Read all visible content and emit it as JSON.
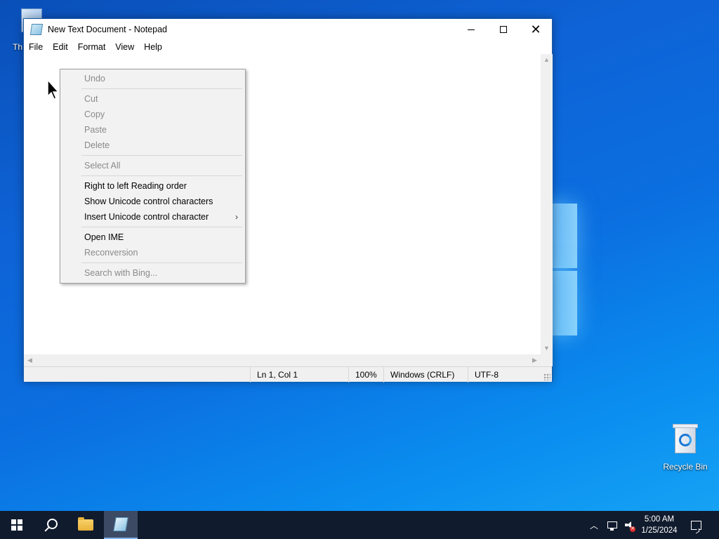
{
  "desktop": {
    "top_icon_label": "Th",
    "recycle_bin_label": "Recycle Bin"
  },
  "window": {
    "title": "New Text Document - Notepad",
    "menu": [
      "File",
      "Edit",
      "Format",
      "View",
      "Help"
    ]
  },
  "status": {
    "position": "Ln 1, Col 1",
    "zoom": "100%",
    "line_endings": "Windows (CRLF)",
    "encoding": "UTF-8"
  },
  "context_menu": {
    "undo": "Undo",
    "cut": "Cut",
    "copy": "Copy",
    "paste": "Paste",
    "delete": "Delete",
    "select_all": "Select All",
    "rtl": "Right to left Reading order",
    "show_unicode": "Show Unicode control characters",
    "insert_unicode": "Insert Unicode control character",
    "open_ime": "Open IME",
    "reconversion": "Reconversion",
    "search_bing": "Search with Bing..."
  },
  "taskbar": {
    "time": "5:00 AM",
    "date": "1/25/2024"
  },
  "icons": {
    "start": "windows-logo-icon",
    "search": "search-icon",
    "explorer": "folder-icon",
    "notepad": "notepad-icon",
    "tray_chevron": "chevron-up-icon",
    "network": "network-icon",
    "volume": "volume-muted-icon",
    "notifications": "notification-icon"
  }
}
